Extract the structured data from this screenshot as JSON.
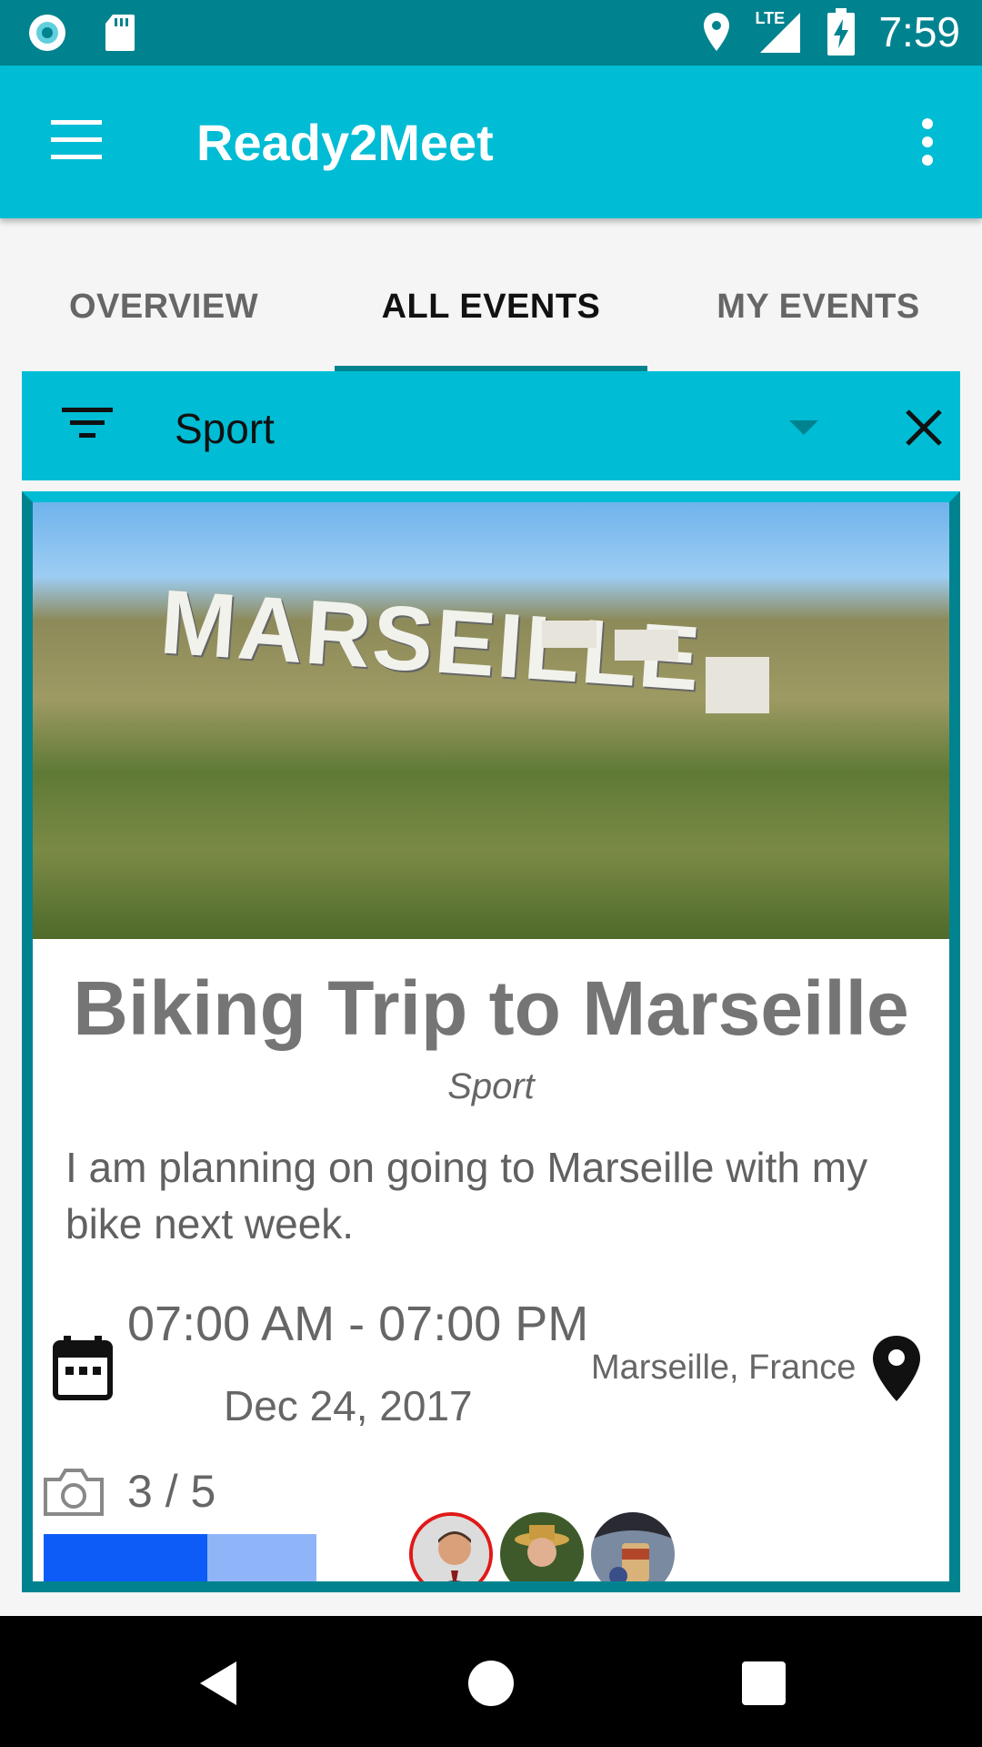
{
  "status_bar": {
    "time": "7:59",
    "network": "LTE"
  },
  "app_bar": {
    "title": "Ready2Meet"
  },
  "tabs": [
    {
      "label": "OVERVIEW",
      "active": false
    },
    {
      "label": "ALL EVENTS",
      "active": true
    },
    {
      "label": "MY EVENTS",
      "active": false
    }
  ],
  "filter": {
    "selected": "Sport"
  },
  "event": {
    "image_text": "MARSEILLE",
    "title": "Biking Trip to Marseille",
    "category": "Sport",
    "description": "I am planning on going to Marseille with my bike next week.",
    "time_range": "07:00 AM - 07:00 PM",
    "date": "Dec 24, 2017",
    "location": "Marseille, France",
    "participants": "3 / 5",
    "participants_fraction": 0.6
  },
  "colors": {
    "status_bar": "#00838f",
    "app_bar": "#00bcd4",
    "accent": "#00838f",
    "progress_fill": "#0d5cf7",
    "progress_track": "#90b4f8"
  },
  "icons": [
    "menu-icon",
    "more-vert-icon",
    "filter-icon",
    "dropdown-caret-icon",
    "close-icon",
    "calendar-icon",
    "location-pin-icon",
    "camera-icon",
    "back-icon",
    "home-icon",
    "recents-icon"
  ]
}
